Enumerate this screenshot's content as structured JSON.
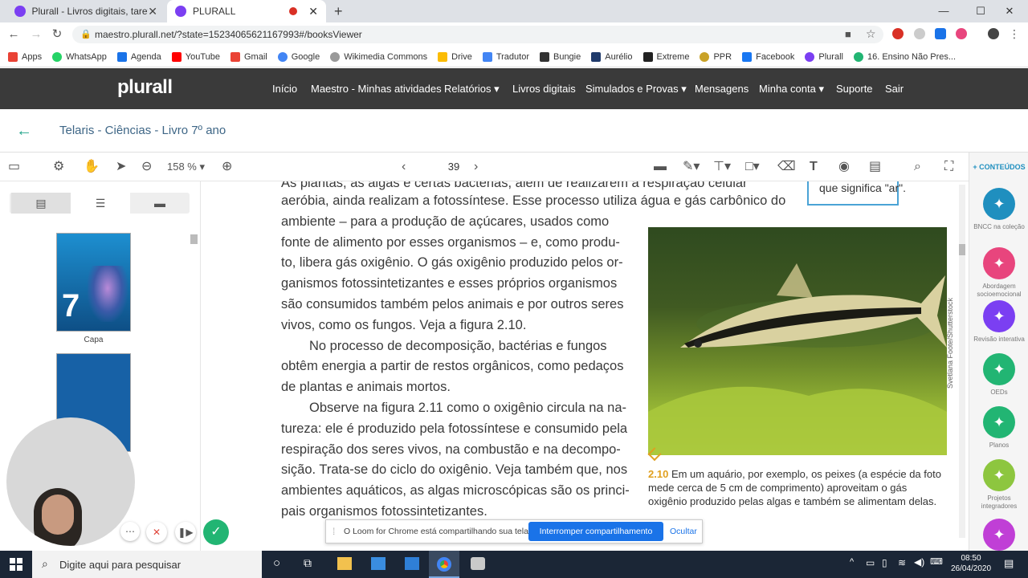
{
  "browser": {
    "tabs": [
      {
        "title": "Plurall - Livros digitais, tarefas, tu"
      },
      {
        "title": "PLURALL"
      }
    ],
    "url": "maestro.plurall.net/?state=15234065621167993#/booksViewer",
    "bookmarks": [
      "Apps",
      "WhatsApp",
      "Agenda",
      "YouTube",
      "Gmail",
      "Google",
      "Wikimedia Commons",
      "Drive",
      "Tradutor",
      "Bungie",
      "Aurélio",
      "Extreme",
      "PPR",
      "Facebook",
      "Plurall",
      "16. Ensino Não Pres..."
    ]
  },
  "site": {
    "logo": "plurall",
    "menu": [
      "Início",
      "Maestro - Minhas atividades",
      "Relatórios",
      "Livros digitais",
      "Simulados e Provas",
      "Mensagens",
      "Minha conta",
      "Suporte",
      "Sair"
    ]
  },
  "book": {
    "title": "Telaris - Ciências - Livro 7º ano"
  },
  "toolbar": {
    "zoom": "158 %",
    "page": "39"
  },
  "sidepanel": {
    "cover_label": "Capa",
    "cover_number": "7"
  },
  "document": {
    "lines_top": [
      "As plantas, as algas e certas bactérias, além de realizarem a respiração celular",
      "aeróbia, ainda realizam a fotossíntese. Esse processo utiliza água e gás carbônico do"
    ],
    "lines_col": [
      "ambiente – para a produção de açúcares, usados como",
      "fonte de alimento por esses organismos – e, como produ-",
      "to, libera gás oxigênio. O gás oxigênio produzido pelos or-",
      "ganismos fotossintetizantes e esses próprios organismos",
      "são consumidos também pelos animais e por outros seres",
      "vivos, como os fungos. Veja a figura 2.10.",
      "No processo de decomposição, bactérias e fungos",
      "obtêm energia a partir de restos orgânicos, como pedaços",
      "de plantas e animais mortos.",
      "Observe na figura 2.11 como o oxigênio circula na na-",
      "tureza: ele é produzido pela fotossíntese e consumido pela",
      "respiração dos seres vivos, na combustão e na decompo-",
      "sição. Trata-se do ciclo do oxigênio. Veja também que, nos",
      "ambientes aquáticos, as algas microscópicas são os princi-",
      "pais organismos fotossintetizantes."
    ],
    "glossary": "que significa \"ar\".",
    "credit": "Svetlana Foote/Shutterstock",
    "caption_num": "2.10",
    "caption": "Em um aquário, por exemplo, os peixes (a espécie da foto mede cerca de 5 cm de comprimento) aproveitam o gás oxigênio produzido pelas algas e também se alimentam delas."
  },
  "rightrail": {
    "header": "+ CONTEÚDOS",
    "items": [
      {
        "label": "BNCC na coleção",
        "color": "#1f8fbf"
      },
      {
        "label": "Abordagem socioemocional",
        "color": "#e8457d"
      },
      {
        "label": "Revisão interativa",
        "color": "#7b3ff2"
      },
      {
        "label": "OEDs",
        "color": "#22b573"
      },
      {
        "label": "Planos",
        "color": "#22b573"
      },
      {
        "label": "Projetos integradores",
        "color": "#8dc63f"
      },
      {
        "label": "",
        "color": "#c03fd6"
      }
    ]
  },
  "loom": {
    "message": "O Loom for Chrome está compartilhando sua tela.",
    "stop": "Interromper compartilhamento",
    "hide": "Ocultar"
  },
  "taskbar": {
    "search": "Digite aqui para pesquisar",
    "time": "08:50",
    "date": "26/04/2020"
  }
}
